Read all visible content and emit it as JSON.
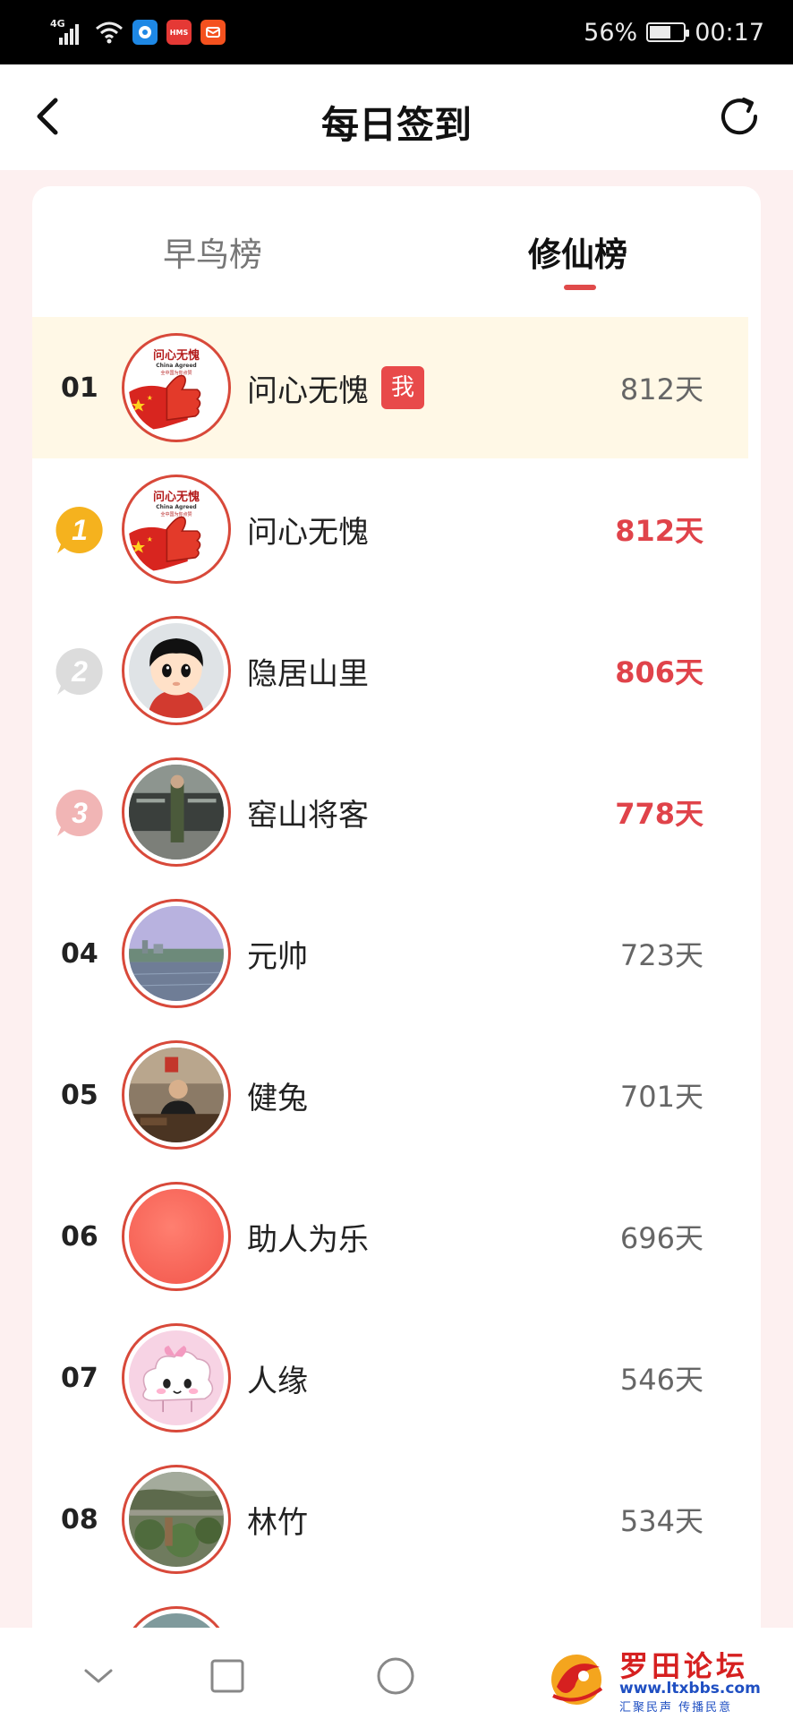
{
  "status_bar": {
    "network": "4G",
    "app_badge_2": "HMS",
    "battery_percent": "56%",
    "battery_level": 0.56,
    "time": "00:17"
  },
  "header": {
    "title": "每日签到",
    "back_icon": "chevron-left-icon",
    "refresh_icon": "refresh-icon"
  },
  "tabs": [
    {
      "label": "早鸟榜",
      "active": false
    },
    {
      "label": "修仙榜",
      "active": true
    }
  ],
  "colors": {
    "accent": "#e0434a",
    "me_row_bg": "#fff8e6",
    "avatar_border": "#d8493a"
  },
  "my_rank": {
    "rank": "01",
    "name": "问心无愧",
    "me_tag": "我",
    "days": "812天",
    "avatar_text_1": "问心无愧",
    "avatar_text_2": "China Agreed",
    "avatar_text_3": "全中国为你点赞"
  },
  "ranking": [
    {
      "rank": "1",
      "medal": "gold",
      "name": "问心无愧",
      "days": "812天"
    },
    {
      "rank": "2",
      "medal": "silver",
      "name": "隐居山里",
      "days": "806天"
    },
    {
      "rank": "3",
      "medal": "bronze",
      "name": "窑山将客",
      "days": "778天"
    },
    {
      "rank": "04",
      "name": "元帅",
      "days": "723天"
    },
    {
      "rank": "05",
      "name": "健兔",
      "days": "701天"
    },
    {
      "rank": "06",
      "name": "助人为乐",
      "days": "696天"
    },
    {
      "rank": "07",
      "name": "人缘",
      "days": "546天"
    },
    {
      "rank": "08",
      "name": "林竹",
      "days": "534天"
    }
  ],
  "nav": {
    "back_icon": "chevron-down-icon",
    "home_icon": "circle-icon",
    "recents_icon": "square-icon"
  },
  "watermark": {
    "title": "罗田论坛",
    "url": "www.ltxbbs.com",
    "slogan": "汇聚民声 传播民意"
  }
}
